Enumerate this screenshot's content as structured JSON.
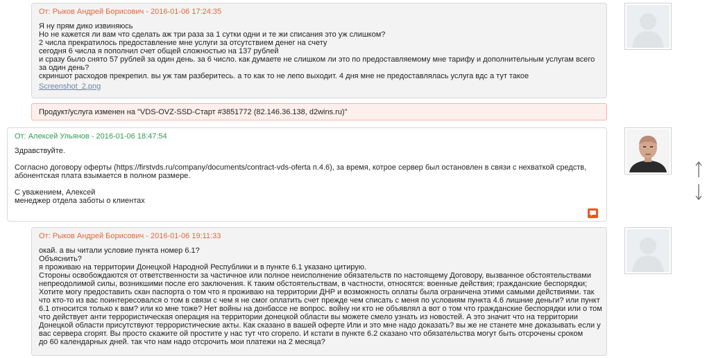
{
  "messages": [
    {
      "header": "От: Рыков Андрей Борисович - 2016-01-06 17:24:35",
      "lines": [
        "Я ну прям дико извиняюсь",
        "Но не кажется ли вам что сделать аж три раза за 1 сутки одни и те жи списания это уж слишком?",
        "2 числа прекратилось предоставление мне услуги за отсутствием денег на счету",
        "сегодня 6 числа я пополнил счет общей сложностью на 137 рублей",
        "и сразу было снято 57 рублей за один день. за 6 число. как думаете не слишком ли это по предоставляемому мне тарифу и дополнительным услугам всего",
        "за один день?",
        "скриншот расходов прекрепил. вы уж там разберитесь. а то как то не лепо выходит. 4 дня мне не предоставлялась услуга вдс а тут такое"
      ],
      "attachment": "Screenshot_2.png"
    },
    {
      "header": "От: Алексей Ульянов - 2016-01-06 18:47:54",
      "lines": [
        "Здравствуйте.",
        "",
        "Согласно договору оферты (https://firstvds.ru/company/documents/contract-vds-oferta п.4.6), за время, котрое сервер был остановлен в связи с нехваткой средств,",
        "абонентская плата взымается в полном размере.",
        "",
        "С уважением, Алексей",
        "менеджер отдела заботы о клиентах"
      ]
    },
    {
      "header": "От: Рыков Андрей Борисович - 2016-01-06 19:11:33",
      "lines": [
        "окай. а вы читали условие пункта номер 6.1?",
        "Объяснить?",
        "я проживаю на территории Донецкой Народной Республики и в пункте 6.1 указано цитирую.",
        "Стороны освобождаются от ответственности за частичное или полное неисполнение обязательств по настоящему Договору, вызванное обстоятельствами",
        "непреодолимой силы, возникшими после его заключения. К таким обстоятельствам, в частности, относятся: военные действия; гражданские беспорядки;",
        "Хотите могу предоставить скан паспорта о том что я проживаю на территории ДНР и возможность оплаты была ограничена этими самыми действиями. так",
        "что кто-то из вас поинтересовался о том в связи с чем я не смог оплатить счет прежде чем списать с меня по условиям пункта 4.6 лишние деньги? или пункт",
        "6.1 относится только к вам? или ко мне тоже? Нет войны на донбассе не вопрос. войну ни кто не объявлял а вот о том что гражданские беспорядки или о том",
        "что действует анти террористическая операция на территории донецкой области вы можете смело узнать из новостей. А это значит что на территории",
        "Донецкой области присутствуют террористические акты. Как сказано в вашей оферте Или и это мне надо доказать? вы же не станете мне доказывать если у",
        "вас сервера сгорят. Вы просто скажите ой простите у нас тут что сгорело. И кстати в пункте 6.2 сказано что обязательства могут быть отсрочены сроком",
        "до 60 календарных дней. так что нам надо отсрочить мои платежи на 2 месяца?"
      ]
    }
  ],
  "notice": "Продукт/услуга изменен на \"VDS-OVZ-SSD-Старт #3851772 (82.146.36.138, d2wins.ru)\"",
  "colors": {
    "client_header": "#e0683f",
    "staff_header": "#2f9a55",
    "notice_bg": "#fdefec",
    "quote_button": "#e8591f"
  },
  "icons": {
    "quote": "quote-icon",
    "scroll": "up-down-arrows-icon"
  }
}
